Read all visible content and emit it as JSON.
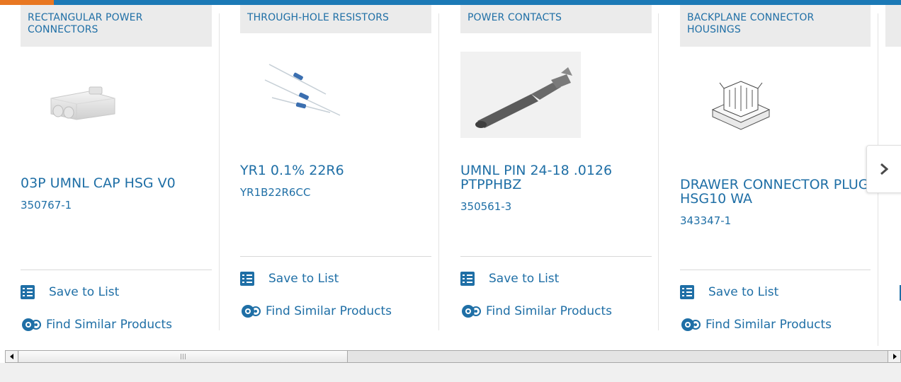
{
  "colors": {
    "accent": "#e87722",
    "brand": "#1b79b6",
    "link": "#1f6fa6"
  },
  "products": [
    {
      "category": "RECTANGULAR POWER CONNECTORS",
      "title": "03P UMNL CAP HSG V0",
      "part_number": "350767-1",
      "save_label": "Save to List",
      "similar_label": "Find Similar Products"
    },
    {
      "category": "THROUGH-HOLE RESISTORS",
      "title": "YR1 0.1% 22R6",
      "part_number": "YR1B22R6CC",
      "save_label": "Save to List",
      "similar_label": "Find Similar Products"
    },
    {
      "category": "POWER CONTACTS",
      "title": "UMNL PIN 24-18 .0126 PTPPHBZ",
      "part_number": "350561-3",
      "save_label": "Save to List",
      "similar_label": "Find Similar Products"
    },
    {
      "category": "BACKPLANE CONNECTOR HOUSINGS",
      "title": "DRAWER CONNECTOR PLUG HSG10 WA",
      "part_number": "343347-1",
      "save_label": "Save to List",
      "similar_label": "Find Similar Products"
    }
  ],
  "icons": {
    "save": "checklist-icon",
    "similar": "gears-icon",
    "next": "chevron-right-icon"
  }
}
